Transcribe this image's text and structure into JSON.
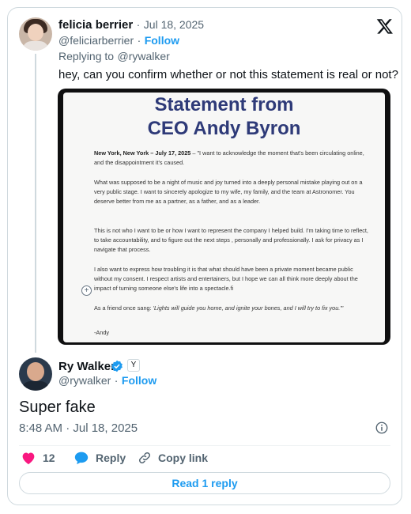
{
  "tweet1": {
    "author_name": "felicia berrier",
    "date": "Jul 18, 2025",
    "date_sep": "·",
    "handle": "@feliciarberrier",
    "follow_sep": "·",
    "follow_label": "Follow",
    "replying_prefix": "Replying to",
    "replying_handle": "@rywalker",
    "text": "hey, can you confirm whether or not this statement is real or not?"
  },
  "statement": {
    "title_line1": "Statement from",
    "title_line2": "CEO Andy Byron",
    "p1_bold": "New York, New York – July 17, 2025",
    "p1_rest": " – \"I want to acknowledge the moment that's been circulating online, and the disappointment it's caused.",
    "p2": "What was supposed to be a night of music and joy turned into a deeply personal mistake playing out on a very public stage. I want to sincerely apologize to my wife, my family, and the team at Astronomer. You deserve better from me as a partner, as a father, and as a leader.",
    "p3": "This is not who I want to be or how I want to represent the company I helped build. I'm taking time to reflect, to take accountability, and to figure out the next steps , personally and professionally. I ask for privacy as I navigate that process.",
    "p4": "I also want to express how troubling it is that what should have been a private moment became public without my consent. I respect artists and entertainers, but I hope we can all think more deeply about the impact of turning someone else's life into a spectacle.fi",
    "p5_lead": "As a friend once sang: ",
    "p5_quote": "'Lights will guide you home, and ignite your bones, and I will try to fix you.'\"",
    "signoff": "-Andy"
  },
  "tweet2": {
    "author_name": "Ry Walker",
    "handle": "@rywalker",
    "follow_sep": "·",
    "follow_label": "Follow",
    "text": "Super fake",
    "timestamp": "8:48 AM · Jul 18, 2025",
    "affiliate_badge": "Y"
  },
  "actions": {
    "like_count": "12",
    "reply_label": "Reply",
    "copy_link_label": "Copy link",
    "read_replies_label": "Read 1 reply"
  },
  "colors": {
    "accent": "#1d9bf0",
    "like": "#f91880",
    "muted": "#536471",
    "statement_title": "#2e3a78"
  },
  "icons": {
    "platform": "x-logo-icon",
    "verified": "verified-badge-icon",
    "info": "info-icon",
    "like": "heart-icon",
    "reply": "speech-bubble-icon",
    "copy_link": "link-icon",
    "expand": "plus-circle-icon"
  }
}
